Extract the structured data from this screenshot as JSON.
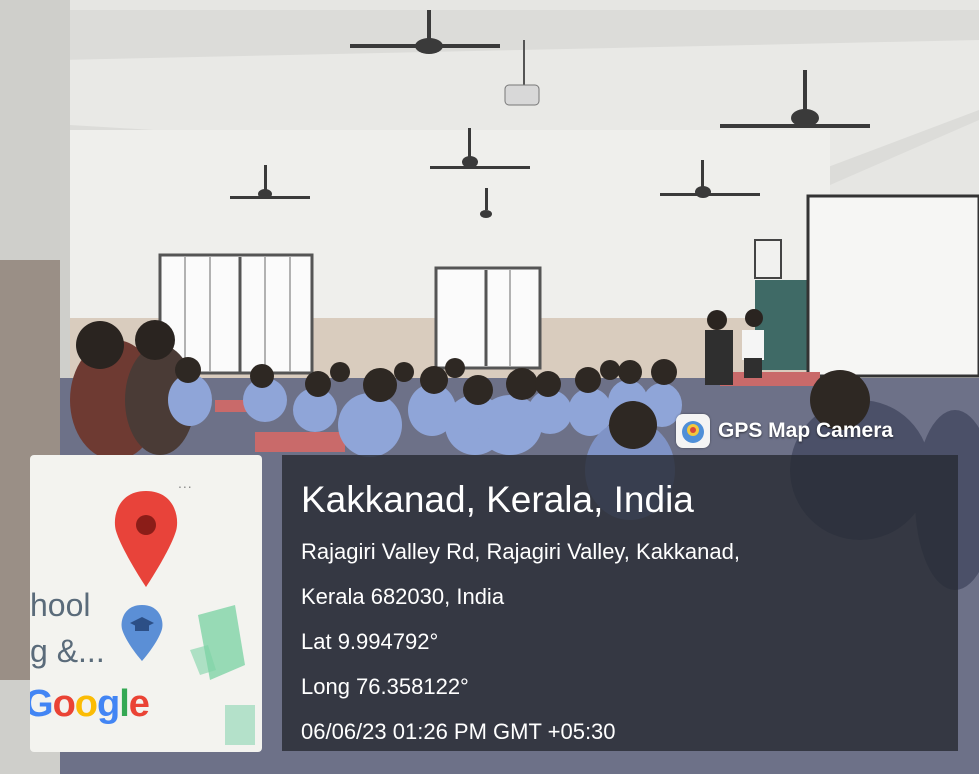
{
  "overlay": {
    "app_name": "GPS Map Camera",
    "place_title": "Kakkanad, Kerala, India",
    "address_line1": "Rajagiri Valley Rd, Rajagiri Valley, Kakkanad,",
    "address_line2": "Kerala 682030, India",
    "latitude": "Lat 9.994792°",
    "longitude": "Long 76.358122°",
    "datetime": "06/06/23 01:26 PM GMT +05:30"
  },
  "map_thumbnail": {
    "label_line1": "hool",
    "label_line2": "g &...",
    "more_dots": "...",
    "google_letters": [
      "G",
      "o",
      "o",
      "g",
      "l",
      "e"
    ],
    "google_colors": [
      "#4285f4",
      "#ea4335",
      "#fbbc05",
      "#4285f4",
      "#34a853",
      "#ea4335"
    ],
    "pin_color": "#e8433a",
    "school_pin_color": "#5b8fd6"
  },
  "colors": {
    "uniform": "#8fa5d8",
    "wall": "#e9e9e6",
    "overlay_bg": "#282c34"
  }
}
